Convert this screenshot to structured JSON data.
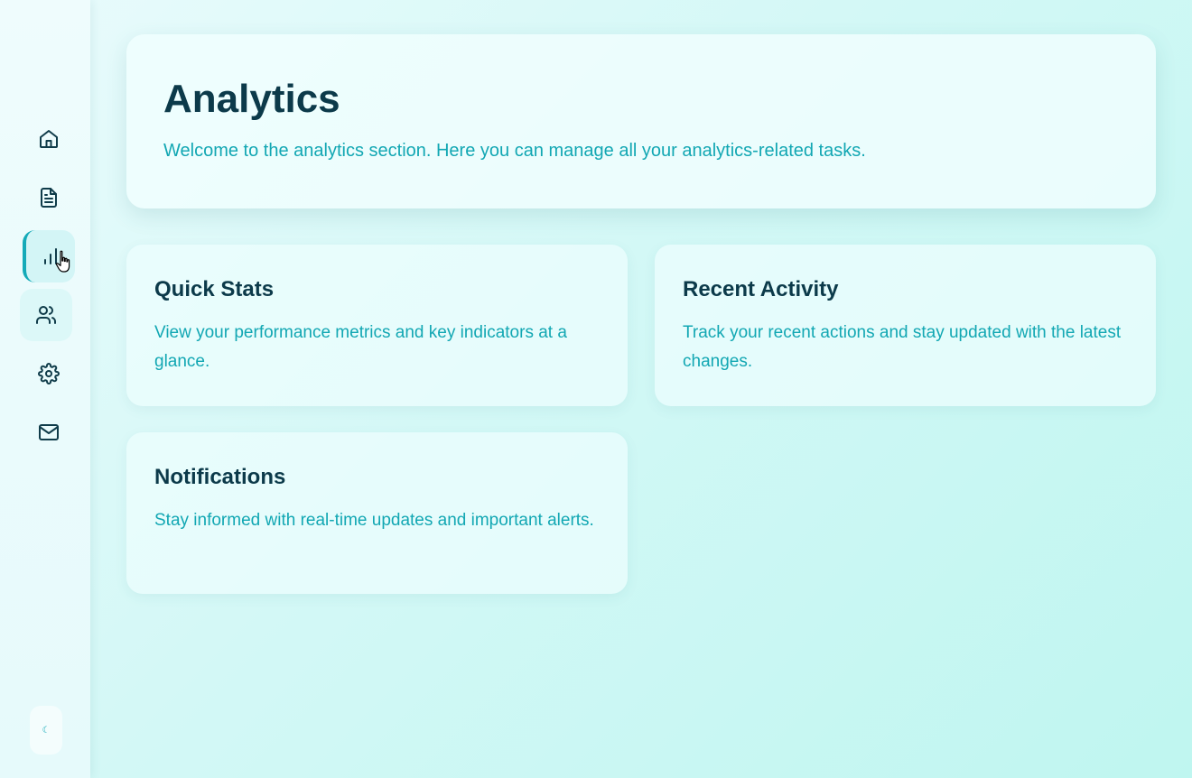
{
  "header": {
    "title": "Analytics",
    "subtitle": "Welcome to the analytics section. Here you can manage all your analytics-related tasks."
  },
  "sidebar": {
    "items": [
      {
        "icon": "home-icon"
      },
      {
        "icon": "document-icon"
      },
      {
        "icon": "analytics-icon",
        "active": true
      },
      {
        "icon": "users-icon"
      },
      {
        "icon": "gear-icon"
      },
      {
        "icon": "mail-icon"
      }
    ],
    "theme_toggle": {
      "icon": "moon-icon",
      "glyph": "☾"
    }
  },
  "cards": [
    {
      "title": "Quick Stats",
      "description": "View your performance metrics and key indicators at a glance."
    },
    {
      "title": "Recent Activity",
      "description": "Track your recent actions and stay updated with the latest changes."
    },
    {
      "title": "Notifications",
      "description": "Stay informed with real-time updates and important alerts."
    }
  ],
  "colors": {
    "accent": "#14aab8",
    "title": "#0c3a4a",
    "text_accent": "#12a7b3"
  }
}
